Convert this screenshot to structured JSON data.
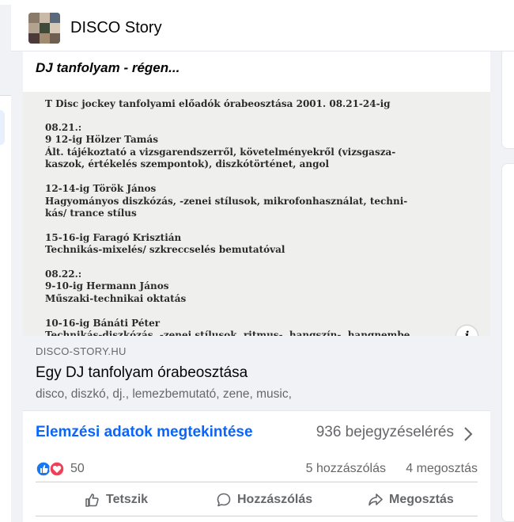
{
  "page": {
    "name": "DISCO Story"
  },
  "post": {
    "text": "DJ tanfolyam - régen..."
  },
  "document": {
    "lines": [
      "T              Disc jockey tanfolyami előadók órabeosztása  2001. 08.21-24-ig",
      "08.21.:",
      " 9 12-ig  Hölzer Tamás",
      "            Ált. tájékoztató a vizsgarendszerről, követelményekről (vizsgasza-",
      "            kaszok, értékelés szempontok), diszkótörténet, angol",
      "12-14-ig  Török János",
      "            Hagyományos diszkózás, -zenei stílusok, mikrofonhasználat, techni-",
      "            kás/ trance stílus",
      "15-16-ig  Faragó Krisztián",
      "            Technikás-mixelés/ szkreccselés bemutatóval",
      "08.22.:",
      "9-10-ig      Hermann János",
      "            Műszaki-technikai oktatás",
      "10-16-ig  Bánáti Péter",
      "            Technikás-diszkózás, -zenei stílusok, ritmus-, hangszín-, hangnembe"
    ]
  },
  "link": {
    "domain": "DISCO-STORY.HU",
    "title": "Egy DJ tanfolyam órabeosztása",
    "description": "disco, diszkó, dj., lemezbemutató, zene, music,"
  },
  "insights": {
    "link_label": "Elemzési adatok megtekintése",
    "engagements": "936 bejegyzéselérés"
  },
  "stats": {
    "reactions": "50",
    "comments": "5 hozzászólás",
    "shares": "4 megosztás"
  },
  "actions": {
    "like": "Tetszik",
    "comment": "Hozzászólás",
    "share": "Megosztás"
  },
  "colors": {
    "accent": "#0866ff",
    "like": "#1877f2",
    "love": "#f33e58"
  }
}
